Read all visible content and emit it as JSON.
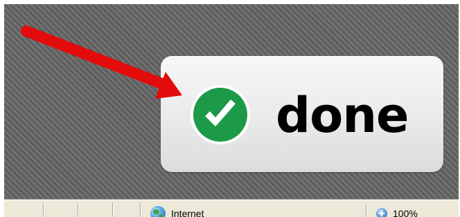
{
  "notification": {
    "label": "done",
    "icon": "check-circle-icon",
    "icon_color": "#1c9a47"
  },
  "annotation": {
    "icon": "red-arrow-icon",
    "color": "#e30b0b"
  },
  "status_bar": {
    "zone_icon": "globe-icon",
    "zone_label": "Internet",
    "zoom_icon": "zoom-icon",
    "zoom_label": "100%"
  }
}
